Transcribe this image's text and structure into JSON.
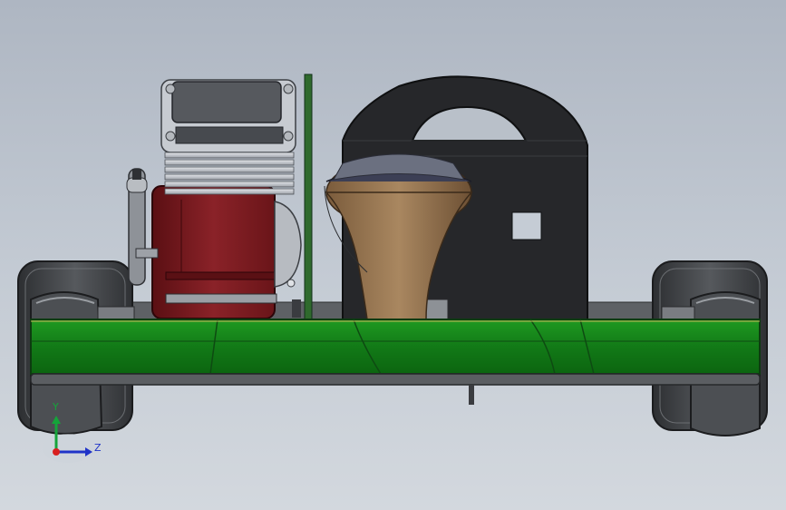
{
  "triad": {
    "y_label": "Y",
    "z_label": "Z",
    "colors": {
      "y": "#15a43a",
      "z": "#1f33c8",
      "x": "#d81f1f"
    }
  },
  "model": {
    "parts": [
      "left-rear-wheel",
      "left-front-wheel",
      "right-rear-wheel",
      "right-front-wheel",
      "engine-block",
      "engine-cylinder-head",
      "exhaust-pipe",
      "fuel-tank",
      "seat-frame",
      "side-pod-panel",
      "chassis-rail",
      "floor-plate"
    ],
    "colors": {
      "tire": "#3f4145",
      "tire_highlight": "#9a9ea3",
      "engine_red": "#7e1a1e",
      "engine_metal": "#c9ccd1",
      "seat_black": "#222325",
      "tank_brown": "#9a7a55",
      "tank_top": "#3c3f55",
      "panel_green": "#127a17",
      "panel_green_light": "#1d951c",
      "chassis_grey": "#6b6e72"
    }
  }
}
